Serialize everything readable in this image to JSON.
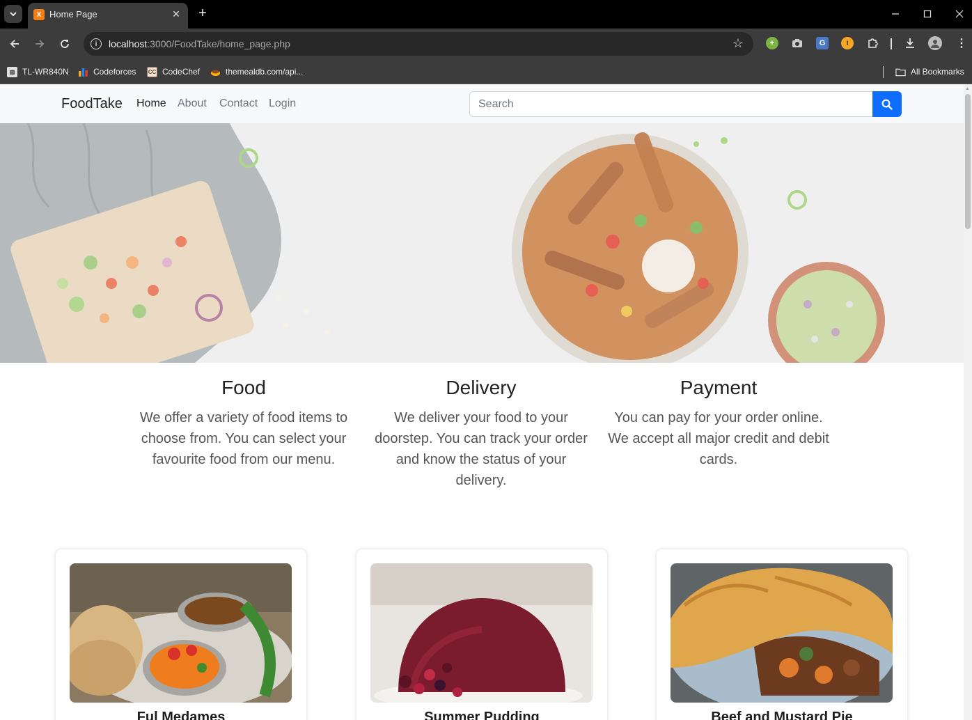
{
  "browser": {
    "tab_title": "Home Page",
    "url_host": "localhost",
    "url_path": ":3000/FoodTake/home_page.php",
    "bookmarks": [
      {
        "label": "TL-WR840N",
        "icon": "router-icon"
      },
      {
        "label": "Codeforces",
        "icon": "codeforces-icon"
      },
      {
        "label": "CodeChef",
        "icon": "codechef-icon"
      },
      {
        "label": "themealdb.com/api...",
        "icon": "themealdb-icon"
      }
    ],
    "all_bookmarks": "All Bookmarks",
    "extension_icons": [
      "add-extension-icon",
      "camera-icon",
      "translate-icon",
      "info-extension-icon",
      "puzzle-icon"
    ]
  },
  "navbar": {
    "brand": "FoodTake",
    "links": [
      "Home",
      "About",
      "Contact",
      "Login"
    ],
    "active_link": "Home",
    "search_placeholder": "Search",
    "search_button_icon": "search-icon",
    "accent_color": "#0d6efd"
  },
  "features": [
    {
      "title": "Food",
      "text": "We offer a variety of food items to choose from. You can select your favourite food from our menu."
    },
    {
      "title": "Delivery",
      "text": "We deliver your food to your doorstep. You can track your order and know the status of your delivery."
    },
    {
      "title": "Payment",
      "text": "You can pay for your order online. We accept all major credit and debit cards."
    }
  ],
  "meals": [
    {
      "name": "Ful Medames"
    },
    {
      "name": "Summer Pudding"
    },
    {
      "name": "Beef and Mustard Pie"
    }
  ]
}
